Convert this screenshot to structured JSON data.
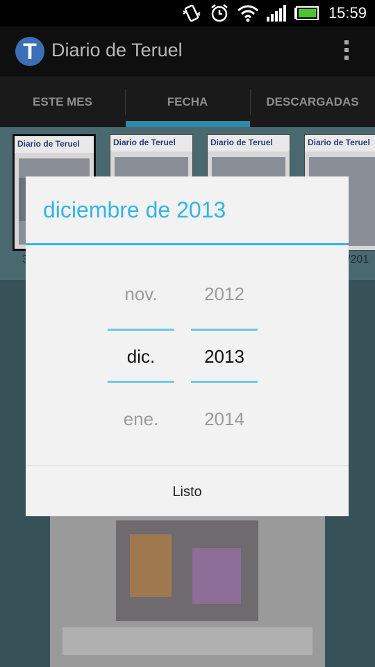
{
  "status_bar": {
    "time": "15:59",
    "icons": [
      "vibrate-icon",
      "alarm-icon",
      "wifi-icon",
      "signal-icon",
      "battery-icon"
    ]
  },
  "app_bar": {
    "logo_letter": "T",
    "title": "Diario de Teruel"
  },
  "tabs": [
    {
      "label": "ESTE MES",
      "selected": false
    },
    {
      "label": "FECHA",
      "selected": true
    },
    {
      "label": "DESCARGADAS",
      "selected": false
    }
  ],
  "thumbnails": {
    "masthead": "Diario de Teruel",
    "dates_visible": [
      "3",
      "/201"
    ]
  },
  "dialog": {
    "title": "diciembre de 2013",
    "month_picker": {
      "prev": "nov.",
      "current": "dic.",
      "next": "ene."
    },
    "year_picker": {
      "prev": "2012",
      "current": "2013",
      "next": "2014"
    },
    "done_label": "Listo"
  },
  "colors": {
    "accent": "#33b5e5",
    "tab_indicator": "#2f89a8",
    "dialog_bg": "#f2f2f2"
  }
}
